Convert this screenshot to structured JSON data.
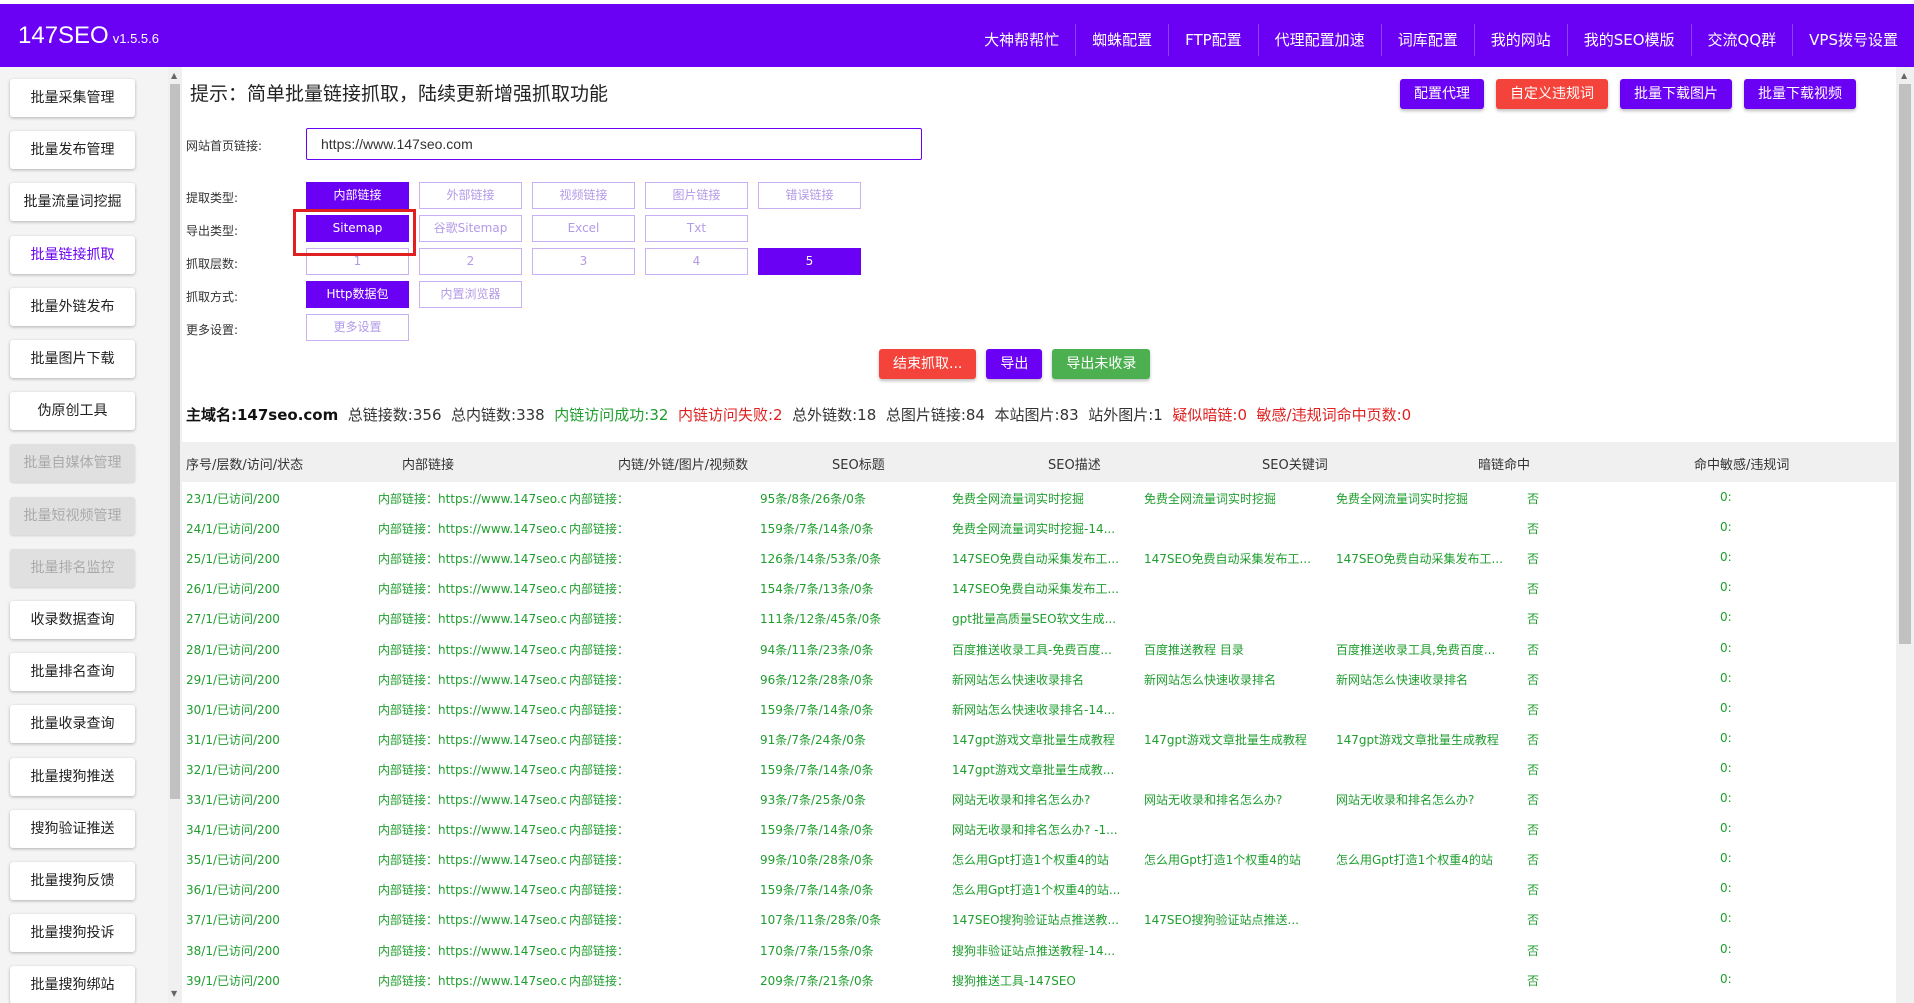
{
  "header": {
    "brand": "147SEO",
    "version": "v1.5.5.6",
    "nav": [
      "大神帮帮忙",
      "蜘蛛配置",
      "FTP配置",
      "代理配置加速",
      "词库配置",
      "我的网站",
      "我的SEO模版",
      "交流QQ群",
      "VPS拨号设置"
    ]
  },
  "sidebar": {
    "items": [
      {
        "label": "批量采集管理",
        "state": "normal"
      },
      {
        "label": "批量发布管理",
        "state": "normal"
      },
      {
        "label": "批量流量词挖掘",
        "state": "normal"
      },
      {
        "label": "批量链接抓取",
        "state": "active"
      },
      {
        "label": "批量外链发布",
        "state": "normal"
      },
      {
        "label": "批量图片下载",
        "state": "normal"
      },
      {
        "label": "伪原创工具",
        "state": "normal"
      },
      {
        "label": "批量自媒体管理",
        "state": "disabled"
      },
      {
        "label": "批量短视频管理",
        "state": "disabled"
      },
      {
        "label": "批量排名监控",
        "state": "disabled"
      },
      {
        "label": "收录数据查询",
        "state": "normal"
      },
      {
        "label": "批量排名查询",
        "state": "normal"
      },
      {
        "label": "批量收录查询",
        "state": "normal"
      },
      {
        "label": "批量搜狗推送",
        "state": "normal"
      },
      {
        "label": "搜狗验证推送",
        "state": "normal"
      },
      {
        "label": "批量搜狗反馈",
        "state": "normal"
      },
      {
        "label": "批量搜狗投诉",
        "state": "normal"
      },
      {
        "label": "批量搜狗绑站",
        "state": "normal"
      }
    ]
  },
  "main": {
    "tip": "提示：简单批量链接抓取，陆续更新增强抓取功能",
    "top_actions": [
      "配置代理",
      "自定义违规词",
      "批量下载图片",
      "批量下载视频"
    ],
    "url_label": "网站首页链接:",
    "url_value": "https://www.147seo.com",
    "fetch_type": {
      "label": "提取类型:",
      "options": [
        "内部链接",
        "外部链接",
        "视频链接",
        "图片链接",
        "错误链接"
      ],
      "selected": "内部链接"
    },
    "export_type": {
      "label": "导出类型:",
      "options": [
        "Sitemap",
        "谷歌Sitemap",
        "Excel",
        "Txt"
      ],
      "selected": "Sitemap"
    },
    "depth": {
      "label": "抓取层数:",
      "options": [
        "1",
        "2",
        "3",
        "4",
        "5"
      ],
      "selected": "5"
    },
    "method": {
      "label": "抓取方式:",
      "options": [
        "Http数据包",
        "内置浏览器"
      ],
      "selected": "Http数据包"
    },
    "more": {
      "label": "更多设置:",
      "button": "更多设置"
    },
    "mid_actions": [
      "结束抓取...",
      "导出",
      "导出未收录"
    ],
    "summary": {
      "domain_label": "主域名:147seo.com",
      "total_links": "总链接数:356",
      "total_internal": "总内链数:338",
      "internal_ok": "内链访问成功:32",
      "internal_fail": "内链访问失败:2",
      "total_external": "总外链数:18",
      "total_images": "总图片链接:84",
      "site_images": "本站图片:83",
      "offsite_images": "站外图片:1",
      "dark_links": "疑似暗链:0",
      "sensitive": "敏感/违规词命中页数:0"
    },
    "table": {
      "headers": [
        "序号/层数/访问/状态",
        "内部链接",
        "内链/外链/图片/视频数",
        "SEO标题",
        "SEO描述",
        "SEO关键词",
        "暗链命中",
        "命中敏感/违规词"
      ],
      "rows": [
        [
          "23/1/已访问/200",
          "内部链接：https://www.147seo.co",
          "内部链接：",
          "95条/8条/26条/0条",
          "免费全网流量词实时挖掘",
          "免费全网流量词实时挖掘",
          "免费全网流量词实时挖掘",
          "否",
          "0:"
        ],
        [
          "24/1/已访问/200",
          "内部链接：https://www.147seo.co",
          "内部链接：",
          "159条/7条/14条/0条",
          "免费全网流量词实时挖掘-14...",
          "",
          "",
          "否",
          "0:"
        ],
        [
          "25/1/已访问/200",
          "内部链接：https://www.147seo.co",
          "内部链接：",
          "126条/14条/53条/0条",
          "147SEO免费自动采集发布工...",
          "147SEO免费自动采集发布工...",
          "147SEO免费自动采集发布工...",
          "否",
          "0:"
        ],
        [
          "26/1/已访问/200",
          "内部链接：https://www.147seo.co",
          "内部链接：",
          "154条/7条/13条/0条",
          "147SEO免费自动采集发布工...",
          "",
          "",
          "否",
          "0:"
        ],
        [
          "27/1/已访问/200",
          "内部链接：https://www.147seo.co",
          "内部链接：",
          "111条/12条/45条/0条",
          "gpt批量高质量SEO软文生成...",
          "",
          "",
          "否",
          "0:"
        ],
        [
          "28/1/已访问/200",
          "内部链接：https://www.147seo.co",
          "内部链接：",
          "94条/11条/23条/0条",
          "百度推送收录工具-免费百度...",
          "百度推送教程 目录",
          "百度推送收录工具,免费百度...",
          "否",
          "0:"
        ],
        [
          "29/1/已访问/200",
          "内部链接：https://www.147seo.co",
          "内部链接：",
          "96条/12条/28条/0条",
          "新网站怎么快速收录排名",
          "新网站怎么快速收录排名",
          "新网站怎么快速收录排名",
          "否",
          "0:"
        ],
        [
          "30/1/已访问/200",
          "内部链接：https://www.147seo.co",
          "内部链接：",
          "159条/7条/14条/0条",
          "新网站怎么快速收录排名-14...",
          "",
          "",
          "否",
          "0:"
        ],
        [
          "31/1/已访问/200",
          "内部链接：https://www.147seo.co",
          "内部链接：",
          "91条/7条/24条/0条",
          "147gpt游戏文章批量生成教程",
          "147gpt游戏文章批量生成教程",
          "147gpt游戏文章批量生成教程",
          "否",
          "0:"
        ],
        [
          "32/1/已访问/200",
          "内部链接：https://www.147seo.co",
          "内部链接：",
          "159条/7条/14条/0条",
          "147gpt游戏文章批量生成教...",
          "",
          "",
          "否",
          "0:"
        ],
        [
          "33/1/已访问/200",
          "内部链接：https://www.147seo.co",
          "内部链接：",
          "93条/7条/25条/0条",
          "网站无收录和排名怎么办?",
          "网站无收录和排名怎么办?",
          "网站无收录和排名怎么办?",
          "否",
          "0:"
        ],
        [
          "34/1/已访问/200",
          "内部链接：https://www.147seo.co",
          "内部链接：",
          "159条/7条/14条/0条",
          "网站无收录和排名怎么办? -1...",
          "",
          "",
          "否",
          "0:"
        ],
        [
          "35/1/已访问/200",
          "内部链接：https://www.147seo.co",
          "内部链接：",
          "99条/10条/28条/0条",
          "怎么用Gpt打造1个权重4的站",
          "怎么用Gpt打造1个权重4的站",
          "怎么用Gpt打造1个权重4的站",
          "否",
          "0:"
        ],
        [
          "36/1/已访问/200",
          "内部链接：https://www.147seo.co",
          "内部链接：",
          "159条/7条/14条/0条",
          "怎么用Gpt打造1个权重4的站...",
          "",
          "",
          "否",
          "0:"
        ],
        [
          "37/1/已访问/200",
          "内部链接：https://www.147seo.co",
          "内部链接：",
          "107条/11条/28条/0条",
          "147SEO搜狗验证站点推送教...",
          "147SEO搜狗验证站点推送...",
          "",
          "否",
          "0:"
        ],
        [
          "38/1/已访问/200",
          "内部链接：https://www.147seo.co",
          "内部链接：",
          "170条/7条/15条/0条",
          "搜狗非验证站点推送教程-14...",
          "",
          "",
          "否",
          "0:"
        ],
        [
          "39/1/已访问/200",
          "内部链接：https://www.147seo.co",
          "内部链接：",
          "209条/7条/21条/0条",
          "搜狗推送工具-147SEO",
          "",
          "",
          "否",
          "0:"
        ]
      ]
    }
  },
  "colors": {
    "brand": "#6a00f4",
    "danger": "#f4433a",
    "success": "#4caf50",
    "row_text": "#1f9e2e"
  }
}
